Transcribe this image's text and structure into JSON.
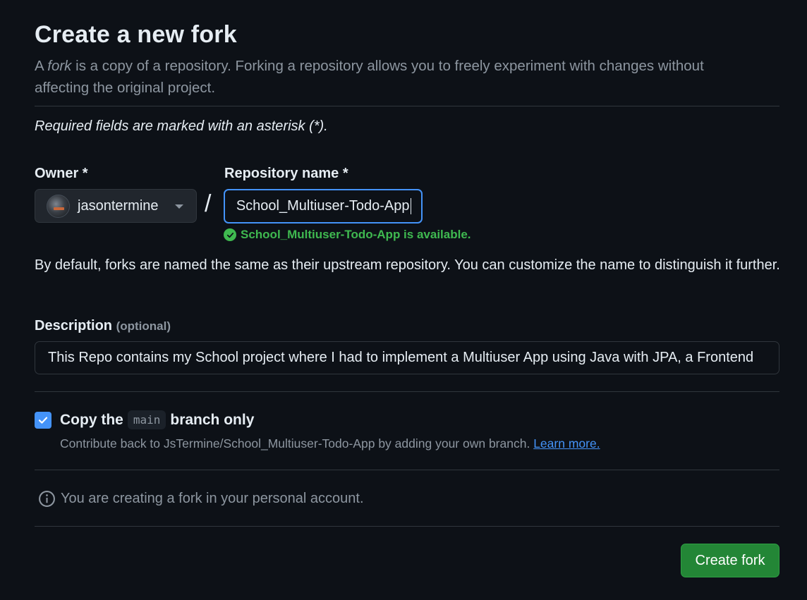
{
  "header": {
    "title": "Create a new fork",
    "subtitle_prefix": "A ",
    "subtitle_em": "fork",
    "subtitle_rest": " is a copy of a repository. Forking a repository allows you to freely experiment with changes without affecting the original project."
  },
  "required_note": "Required fields are marked with an asterisk (*).",
  "owner": {
    "label": "Owner *",
    "value": "jasontermine"
  },
  "separator": "/",
  "repository": {
    "label": "Repository name *",
    "value": "School_Multiuser-Todo-App",
    "availability": "School_Multiuser-Todo-App is available."
  },
  "default_note": "By default, forks are named the same as their upstream repository. You can customize the name to distinguish it further.",
  "description": {
    "label": "Description",
    "optional": "(optional)",
    "value": "This Repo contains my School project where I had to implement a Multiuser App using Java with JPA, a Frontend"
  },
  "copy_branch": {
    "checked": true,
    "label_before": "Copy the",
    "branch": "main",
    "label_after": "branch only",
    "help_text": "Contribute back to JsTermine/School_Multiuser-Todo-App by adding your own branch.",
    "learn_more": "Learn more."
  },
  "personal_note": "You are creating a fork in your personal account.",
  "submit_label": "Create fork",
  "colors": {
    "background": "#0d1117",
    "accent": "#4493f8",
    "success": "#3fb950",
    "primary_button": "#238636"
  },
  "icons": {
    "availability": "check-circle-icon",
    "owner_dropdown": "caret-down-icon",
    "personal_note": "info-icon",
    "checkbox": "checkmark-icon"
  }
}
